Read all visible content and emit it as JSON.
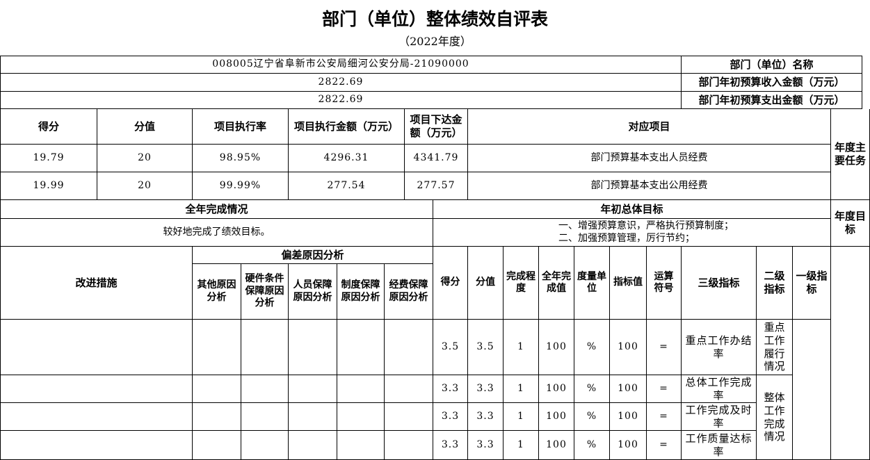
{
  "title": "部门（单位）整体绩效自评表",
  "subtitle": "（2022年度）",
  "info": {
    "unit_label": "部门（单位）名称",
    "unit_value": "008005辽宁省阜新市公安局细河公安分局-21090000",
    "income_label": "部门年初预算收入金额（万元）",
    "income_value": "2822.69",
    "expense_label": "部门年初预算支出金额（万元）",
    "expense_value": "2822.69"
  },
  "tasks": {
    "section_label": "年度主要任务",
    "headers": {
      "project": "对应项目",
      "allocated": "项目下达金额（万元）",
      "executed": "项目执行金额（万元）",
      "rate": "项目执行率",
      "score_value": "分值",
      "score": "得分"
    },
    "rows": [
      {
        "project": "部门预算基本支出人员经费",
        "allocated": "4341.79",
        "executed": "4296.31",
        "rate": "98.95%",
        "score_value": "20",
        "score": "19.79"
      },
      {
        "project": "部门预算基本支出公用经费",
        "allocated": "277.57",
        "executed": "277.54",
        "rate": "99.99%",
        "score_value": "20",
        "score": "19.99"
      }
    ]
  },
  "targets": {
    "section_label": "年度目标",
    "initial_header": "年初总体目标",
    "completion_header": "全年完成情况",
    "initial_lines": [
      "一、增强预算意识，严格执行预算制度；",
      "二、加强预算管理，厉行节约；"
    ],
    "completion": "较好地完成了绩效目标。"
  },
  "indicators": {
    "headers": {
      "level1": "一级指标",
      "level2": "二级指标",
      "level3": "三级指标",
      "operator": "运算符号",
      "target_value": "指标值",
      "unit": "度量单位",
      "actual": "全年完成值",
      "degree": "完成程度",
      "score_value": "分值",
      "score": "得分",
      "deviation_group": "偏差原因分析",
      "funding": "经费保障原因分析",
      "system": "制度保障原因分析",
      "personnel": "人员保障原因分析",
      "hardware": "硬件条件保障原因分析",
      "other": "其他原因分析",
      "improvement": "改进措施"
    },
    "level2_groups": [
      "重点工作履行情况",
      "整体工作完成情况"
    ],
    "rows": [
      {
        "level3": "重点工作办结率",
        "operator": "=",
        "target_value": "100",
        "unit": "%",
        "actual": "100",
        "degree": "1",
        "score_value": "3.5",
        "score": "3.5"
      },
      {
        "level3": "总体工作完成率",
        "operator": "=",
        "target_value": "100",
        "unit": "%",
        "actual": "100",
        "degree": "1",
        "score_value": "3.3",
        "score": "3.3"
      },
      {
        "level3": "工作完成及时率",
        "operator": "=",
        "target_value": "100",
        "unit": "%",
        "actual": "100",
        "degree": "1",
        "score_value": "3.3",
        "score": "3.3"
      },
      {
        "level3": "工作质量达标率",
        "operator": "=",
        "target_value": "100",
        "unit": "%",
        "actual": "100",
        "degree": "1",
        "score_value": "3.3",
        "score": "3.3"
      }
    ]
  }
}
